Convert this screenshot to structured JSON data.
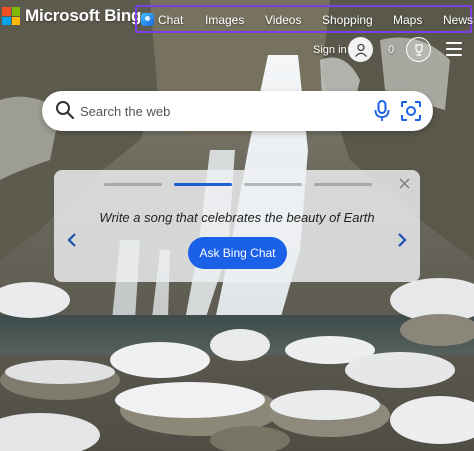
{
  "brand": {
    "name": "Microsoft Bing",
    "logo_colors": [
      "#f25022",
      "#7fba00",
      "#00a4ef",
      "#ffb900"
    ]
  },
  "nav": {
    "items": [
      {
        "label": "Chat",
        "icon": "bing-chat-icon"
      },
      {
        "label": "Images"
      },
      {
        "label": "Videos"
      },
      {
        "label": "Shopping"
      },
      {
        "label": "Maps"
      },
      {
        "label": "News"
      }
    ],
    "highlight_color": "#7b3fe4"
  },
  "account": {
    "signin_label": "Sign in",
    "rewards_count": "0"
  },
  "search": {
    "placeholder": "Search the web"
  },
  "chat_card": {
    "prompt": "Write a song that celebrates the beauty of Earth",
    "button_label": "Ask Bing Chat",
    "pager_count": 4,
    "active_index": 1,
    "accent_color": "#1b61e8"
  }
}
